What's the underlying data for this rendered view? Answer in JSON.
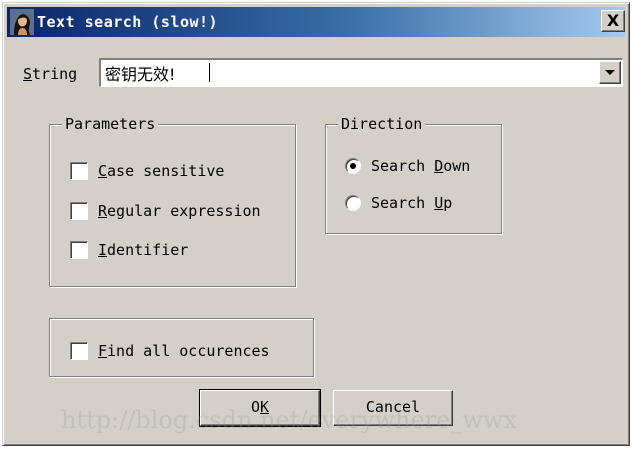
{
  "window": {
    "title": "Text search (slow!)",
    "close_label": "X",
    "icon": "app-portrait-icon"
  },
  "search": {
    "label_mnemonic": "S",
    "label_rest": "tring",
    "value": "密钥无效!"
  },
  "parameters": {
    "legend": "Parameters",
    "options": [
      {
        "mnemonic": "C",
        "rest": "ase sensitive",
        "checked": false
      },
      {
        "mnemonic": "R",
        "rest": "egular expression",
        "checked": false
      },
      {
        "mnemonic": "I",
        "rest": "dentifier",
        "checked": false
      }
    ]
  },
  "direction": {
    "legend": "Direction",
    "options": [
      {
        "before": "Search ",
        "mnemonic": "D",
        "after": "own",
        "selected": true
      },
      {
        "before": "Search ",
        "mnemonic": "U",
        "after": "p",
        "selected": false
      }
    ]
  },
  "find_all": {
    "mnemonic": "F",
    "rest": "ind all occurences",
    "checked": false
  },
  "buttons": {
    "ok": {
      "before": "O",
      "mnemonic": "K"
    },
    "cancel": {
      "label": "Cancel"
    }
  },
  "watermark": "http://blog.csdn.net/everywhere_wwx",
  "colors": {
    "dialog_bg": "#d4d0c8",
    "title_bar_start": "#0a246a",
    "title_bar_end": "#a6caf0"
  }
}
